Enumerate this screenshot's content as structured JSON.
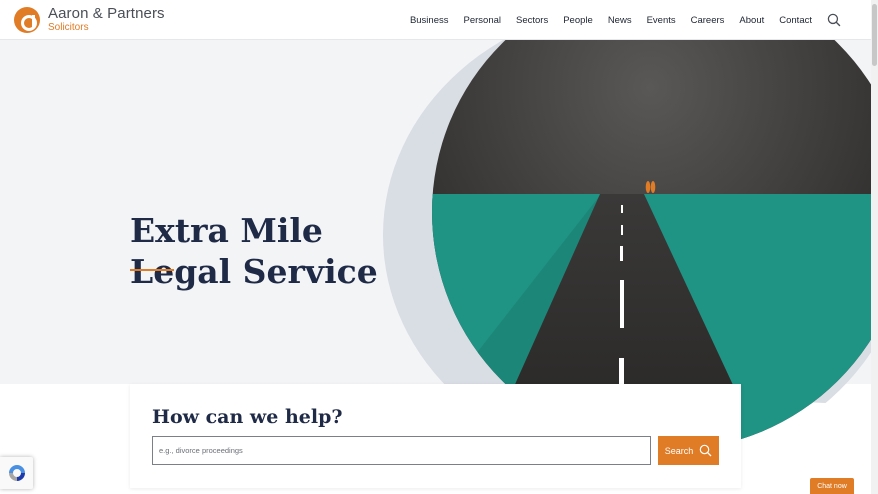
{
  "brand": {
    "name": "Aaron & Partners",
    "sub": "Solicitors",
    "accent_color": "#e07b26",
    "navy_color": "#1f2a47",
    "teal_color": "#1f9384"
  },
  "nav": {
    "items": [
      {
        "label": "Business"
      },
      {
        "label": "Personal"
      },
      {
        "label": "Sectors"
      },
      {
        "label": "People"
      },
      {
        "label": "News"
      },
      {
        "label": "Events"
      },
      {
        "label": "Careers"
      },
      {
        "label": "About"
      },
      {
        "label": "Contact"
      }
    ],
    "search_icon": "search-icon"
  },
  "hero": {
    "headline_line1": "Extra Mile",
    "headline_line2": "Legal Service"
  },
  "help": {
    "title": "How can we help?",
    "placeholder": "e.g., divorce proceedings",
    "search_label": "Search",
    "search_icon": "search-icon"
  },
  "recaptcha": {
    "icon": "recaptcha-icon"
  },
  "chat": {
    "label": "Chat now"
  }
}
